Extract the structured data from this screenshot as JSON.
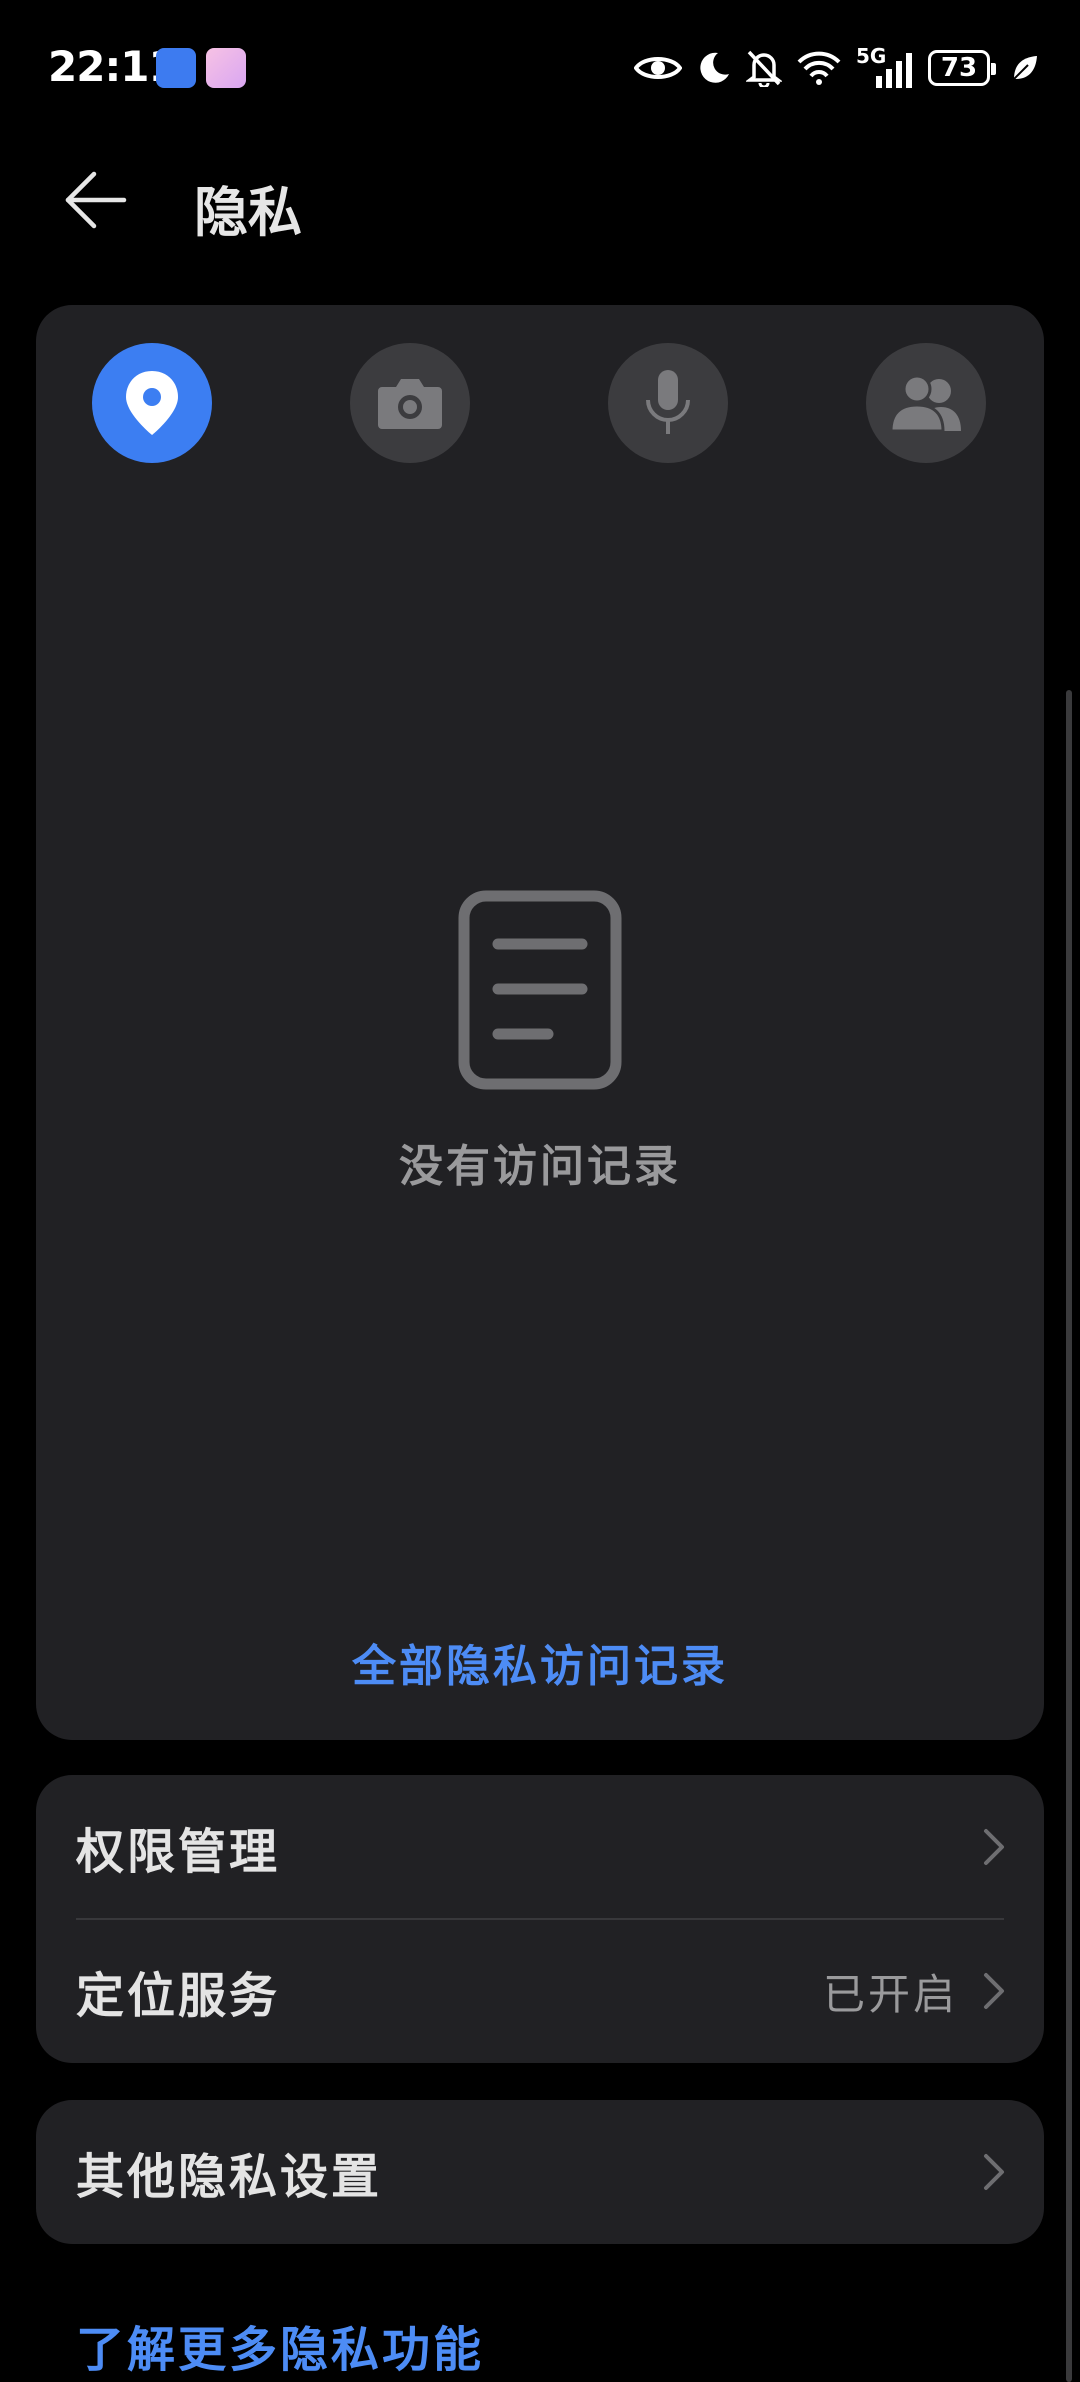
{
  "status_bar": {
    "time": "22:11",
    "network": "5G",
    "battery": "73",
    "icons": [
      "app-store-icon",
      "gallery-icon",
      "eye-icon",
      "moon-icon",
      "bell-off-icon",
      "wifi-icon",
      "signal-icon",
      "battery-icon",
      "leaf-icon"
    ]
  },
  "header": {
    "title": "隐私",
    "back_icon": "arrow-left-icon"
  },
  "records": {
    "tabs": [
      {
        "icon": "location-pin-icon",
        "active": true
      },
      {
        "icon": "camera-icon",
        "active": false
      },
      {
        "icon": "microphone-icon",
        "active": false
      },
      {
        "icon": "contacts-icon",
        "active": false
      }
    ],
    "empty_text": "没有访问记录",
    "all_records_link": "全部隐私访问记录"
  },
  "settings": {
    "permission_management": {
      "label": "权限管理"
    },
    "location_service": {
      "label": "定位服务",
      "value": "已开启"
    },
    "other_privacy": {
      "label": "其他隐私设置"
    }
  },
  "footer": {
    "learn_more": "了解更多隐私功能"
  },
  "colors": {
    "background": "#000000",
    "card": "#212124",
    "accent": "#3c7ef2",
    "link": "#4d8cf5"
  }
}
